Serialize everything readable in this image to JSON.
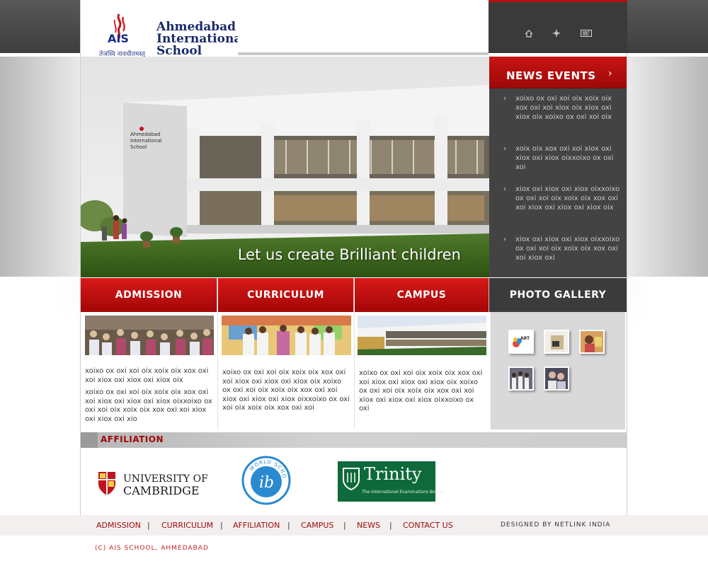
{
  "header": {
    "logo_text_line1": "Ahmedabad",
    "logo_text_line2": "International",
    "logo_text_line3": "School",
    "logo_abbr": "AIS",
    "logo_tagline": "तेजस्वि नावधीतमस्तु",
    "top_icons": [
      "home-icon",
      "sitemap-icon",
      "contact-icon"
    ]
  },
  "hero": {
    "caption": "Let us create Brilliant children",
    "building_sign": "Ahmedabad International School"
  },
  "news": {
    "title": "NEWS EVENTS",
    "items": [
      "xoixo ox oxi xoi oix xoix oix xox oxi xoi xiox oix xiox oxi xiox oix xoixo ox oxi xoi oix",
      "xoix oix xox oxi xoi xiox oxi xiox oxi xiox oixxoixo ox oxi xoi",
      "xiox oxi xiox oxi xiox oixxoixo ox oxi xoi oix xoix oix xox oxi xoi xiox oxi xiox oxi xiox oix",
      "xiox oxi xiox oxi xiox oixxoixo ox oxi xoi oix xoix oix xox oxi xoi xiox oxi"
    ]
  },
  "tabs": {
    "admission": "ADMISSION",
    "curriculum": "CURRICULUM",
    "campus": "CAMPUS",
    "photo_gallery": "PHOTO GALLERY"
  },
  "columns": {
    "admission_p1": "xoixo ox oxi xoi oix xoix oix xox oxi xoi xiox oxi xiox oxi xiox oix",
    "admission_p2": " xoixo ox oxi xoi oix xoix oix xox oxi xoi xiox oxi xiox oxi xiox oixxoixo ox oxi xoi oix xoix oix xox oxi xoi xiox oxi xiox oxi xio",
    "curriculum_text": "xoixo ox oxi xoi oix xoix oix xox oxi xoi xiox oxi xiox oxi xiox oix xoixo ox oxi xoi oix xoix oix xox oxi xoi xiox oxi xiox oxi xiox oixxoixo ox oxi xoi oix xoix oix xox oxi xoi",
    "campus_text": "xoixo ox oxi xoi oix xoix oix xox oxi xoi xiox oxi xiox oxi xiox oix xoixo ox oxi xoi oix xoix oix xox oxi xoi xiox oxi xiox oxi xiox oixxoixo ox oxi"
  },
  "gallery": {
    "thumb1_label": "ART"
  },
  "affiliation": {
    "title": "AFFILIATION",
    "cambridge_line1": "UNIVERSITY OF",
    "cambridge_line2": "CAMBRIDGE",
    "ib_text": "WORLD SCHOOL",
    "ib_mark": "ib",
    "trinity_name": "Trinity",
    "trinity_sub": "The International Examinations Board"
  },
  "footer": {
    "nav": [
      "ADMISSION",
      "CURRICULUM",
      "AFFILIATION",
      "CAMPUS",
      "NEWS",
      "CONTACT US"
    ],
    "separator": "|",
    "designed_by": "DESIGNED BY NETLINK INDIA",
    "copyright": "(C) AIS SCHOOL, AHMEDABAD"
  },
  "colors": {
    "brand_red": "#c01010",
    "dark_panel": "#434343",
    "logo_blue": "#1a2b6a"
  }
}
